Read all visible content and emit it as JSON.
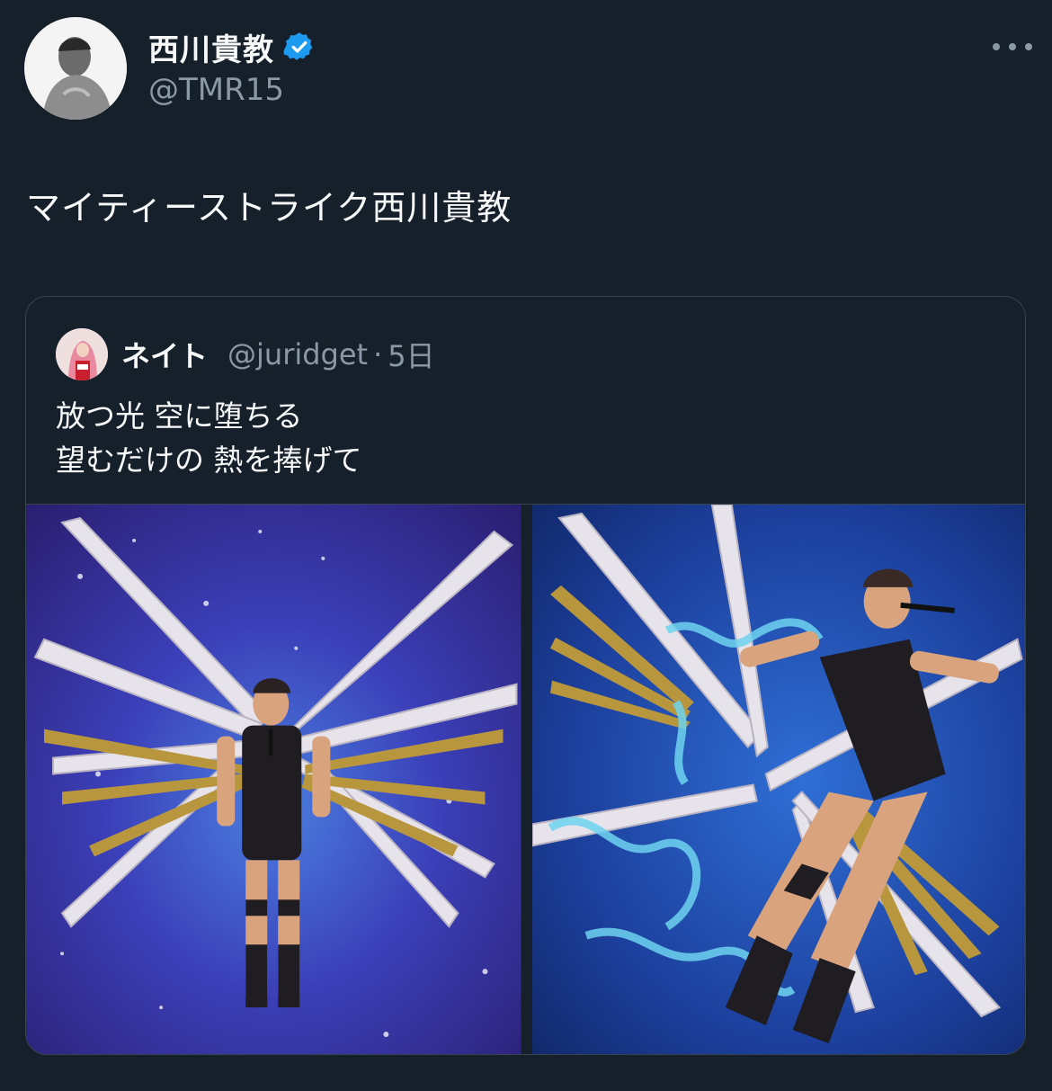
{
  "author": {
    "display_name": "西川貴教",
    "handle": "@TMR15",
    "avatar_icon": "profile-photo",
    "verified_icon": "verified-badge-icon"
  },
  "tweet": {
    "text": "マイティーストライク西川貴教"
  },
  "more_icon": "more-options-icon",
  "quoted_tweet": {
    "display_name": "ネイト",
    "handle": "@juridget",
    "separator": "·",
    "time": "5日",
    "text_lines": [
      "放つ光 空に堕ちる",
      "望むだけの 熱を捧げて"
    ],
    "media": [
      {
        "icon": "photo-figure-winged-front"
      },
      {
        "icon": "photo-figure-winged-lying"
      }
    ]
  },
  "colors": {
    "background": "#15202b",
    "text": "#f7f9f9",
    "secondary_text": "#8b98a5",
    "border": "#38444d",
    "verified": "#1d9bf0"
  }
}
